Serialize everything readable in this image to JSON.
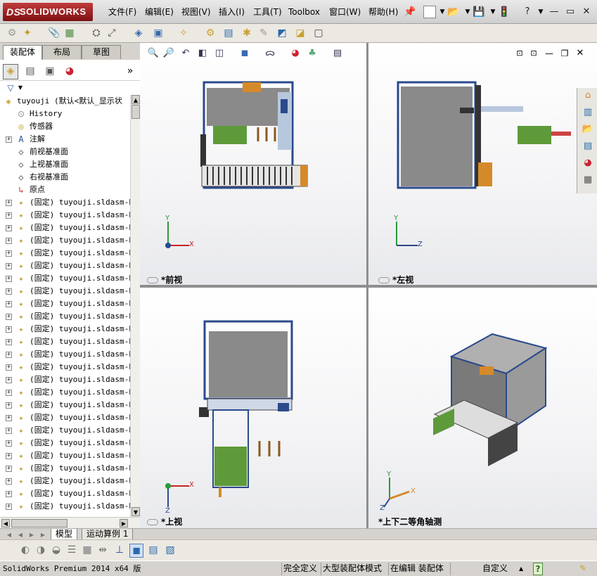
{
  "app": {
    "logo_prefix": "DS",
    "logo_text": "SOLIDWORKS"
  },
  "menu": [
    "文件(F)",
    "编辑(E)",
    "视图(V)",
    "插入(I)",
    "工具(T)",
    "Toolbox",
    "窗口(W)",
    "帮助(H)"
  ],
  "window_controls": {
    "help": "?",
    "minimize": "—",
    "restore": "▭",
    "close": "✕"
  },
  "panel_tabs": [
    "装配体",
    "布局",
    "草图"
  ],
  "feature_tree": {
    "root": "tuyouji  (默认<默认_显示状",
    "items": [
      {
        "label": "History",
        "icon": "history-icon"
      },
      {
        "label": "传感器",
        "icon": "sensor-icon"
      },
      {
        "label": "注解",
        "icon": "annotation-icon"
      },
      {
        "label": "前视基准面",
        "icon": "plane-icon"
      },
      {
        "label": "上视基准面",
        "icon": "plane-icon"
      },
      {
        "label": "右视基准面",
        "icon": "plane-icon"
      },
      {
        "label": "原点",
        "icon": "origin-icon"
      }
    ],
    "component_label": "(固定) tuyouji.sldasm-P",
    "component_count": 25
  },
  "viewports": {
    "front": "*前视",
    "left": "*左视",
    "top": "*上视",
    "iso": "*上下二等角轴测"
  },
  "axes": {
    "x": "X",
    "y": "Y",
    "z": "Z"
  },
  "bottom_tabs": [
    "模型",
    "运动算例 1"
  ],
  "status": {
    "product": "SolidWorks Premium 2014 x64 版",
    "definition": "完全定义",
    "mode": "大型装配体模式",
    "editing": "在编辑 装配体",
    "units": "自定义",
    "caret": "▲",
    "help": "?"
  },
  "colors": {
    "logo_red": "#a01f1f",
    "frame_blue": "#2b4a8c",
    "panel_gray": "#8a8a8a",
    "part_green": "#5e9a3a",
    "part_orange": "#d58a2a"
  }
}
